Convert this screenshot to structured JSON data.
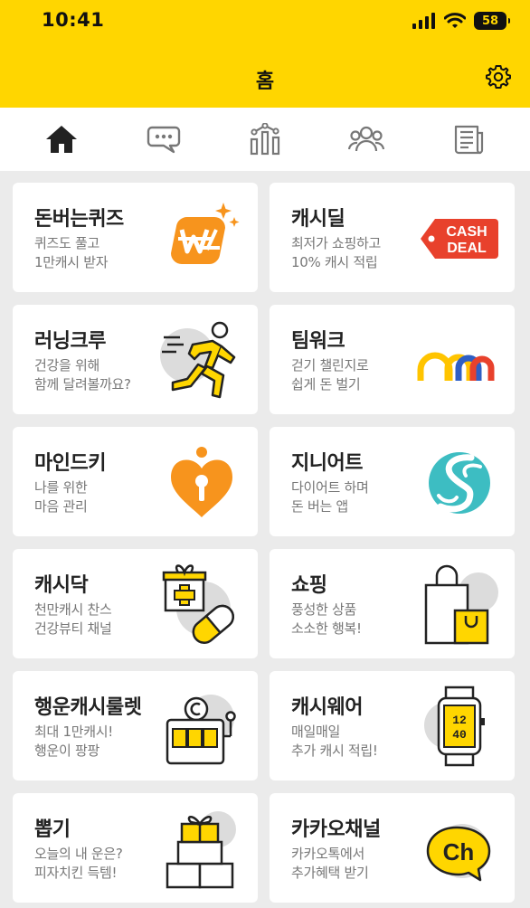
{
  "status_bar": {
    "time": "10:41",
    "battery": "58"
  },
  "header": {
    "title": "홈"
  },
  "tabs": [
    {
      "icon": "home-icon"
    },
    {
      "icon": "chat-icon"
    },
    {
      "icon": "chart-icon"
    },
    {
      "icon": "friends-icon"
    },
    {
      "icon": "news-icon"
    }
  ],
  "cards": [
    {
      "title": "돈버는퀴즈",
      "line1": "퀴즈도 풀고",
      "line2": "1만캐시 받자",
      "icon": "quiz-coin-icon"
    },
    {
      "title": "캐시딜",
      "line1": "최저가 쇼핑하고",
      "line2": "10% 캐시 적립",
      "icon": "cash-deal-tag-icon",
      "badge_line1": "CASH",
      "badge_line2": "DEAL"
    },
    {
      "title": "러닝크루",
      "line1": "건강을 위해",
      "line2": "함께 달려볼까요?",
      "icon": "runner-icon"
    },
    {
      "title": "팀워크",
      "line1": "걷기 챌린지로",
      "line2": "쉽게 돈 벌기",
      "icon": "teamwork-arches-icon"
    },
    {
      "title": "마인드키",
      "line1": "나를 위한",
      "line2": "마음 관리",
      "icon": "heart-lock-icon"
    },
    {
      "title": "지니어트",
      "line1": "다이어트 하며",
      "line2": "돈 버는 앱",
      "icon": "geniet-logo-icon"
    },
    {
      "title": "캐시닥",
      "line1": "천만캐시 찬스",
      "line2": "건강뷰티 채널",
      "icon": "medicine-icon"
    },
    {
      "title": "쇼핑",
      "line1": "풍성한 상품",
      "line2": "소소한 행복!",
      "icon": "shopping-bag-icon"
    },
    {
      "title": "행운캐시룰렛",
      "line1": "최대 1만캐시!",
      "line2": "행운이 팡팡",
      "icon": "slot-machine-icon"
    },
    {
      "title": "캐시웨어",
      "line1": "매일매일",
      "line2": "추가 캐시 적립!",
      "icon": "smartwatch-icon",
      "watch_line1": "12",
      "watch_line2": "40"
    },
    {
      "title": "뽑기",
      "line1": "오늘의 내 운은?",
      "line2": "피자치킨 득템!",
      "icon": "gift-boxes-icon"
    },
    {
      "title": "카카오채널",
      "line1": "카카오톡에서",
      "line2": "추가혜택 받기",
      "icon": "kakao-channel-icon",
      "badge": "Ch"
    }
  ],
  "colors": {
    "accent": "#ffd600",
    "orange": "#f7941d",
    "red": "#e8412c",
    "teal": "#3dbdc2"
  }
}
